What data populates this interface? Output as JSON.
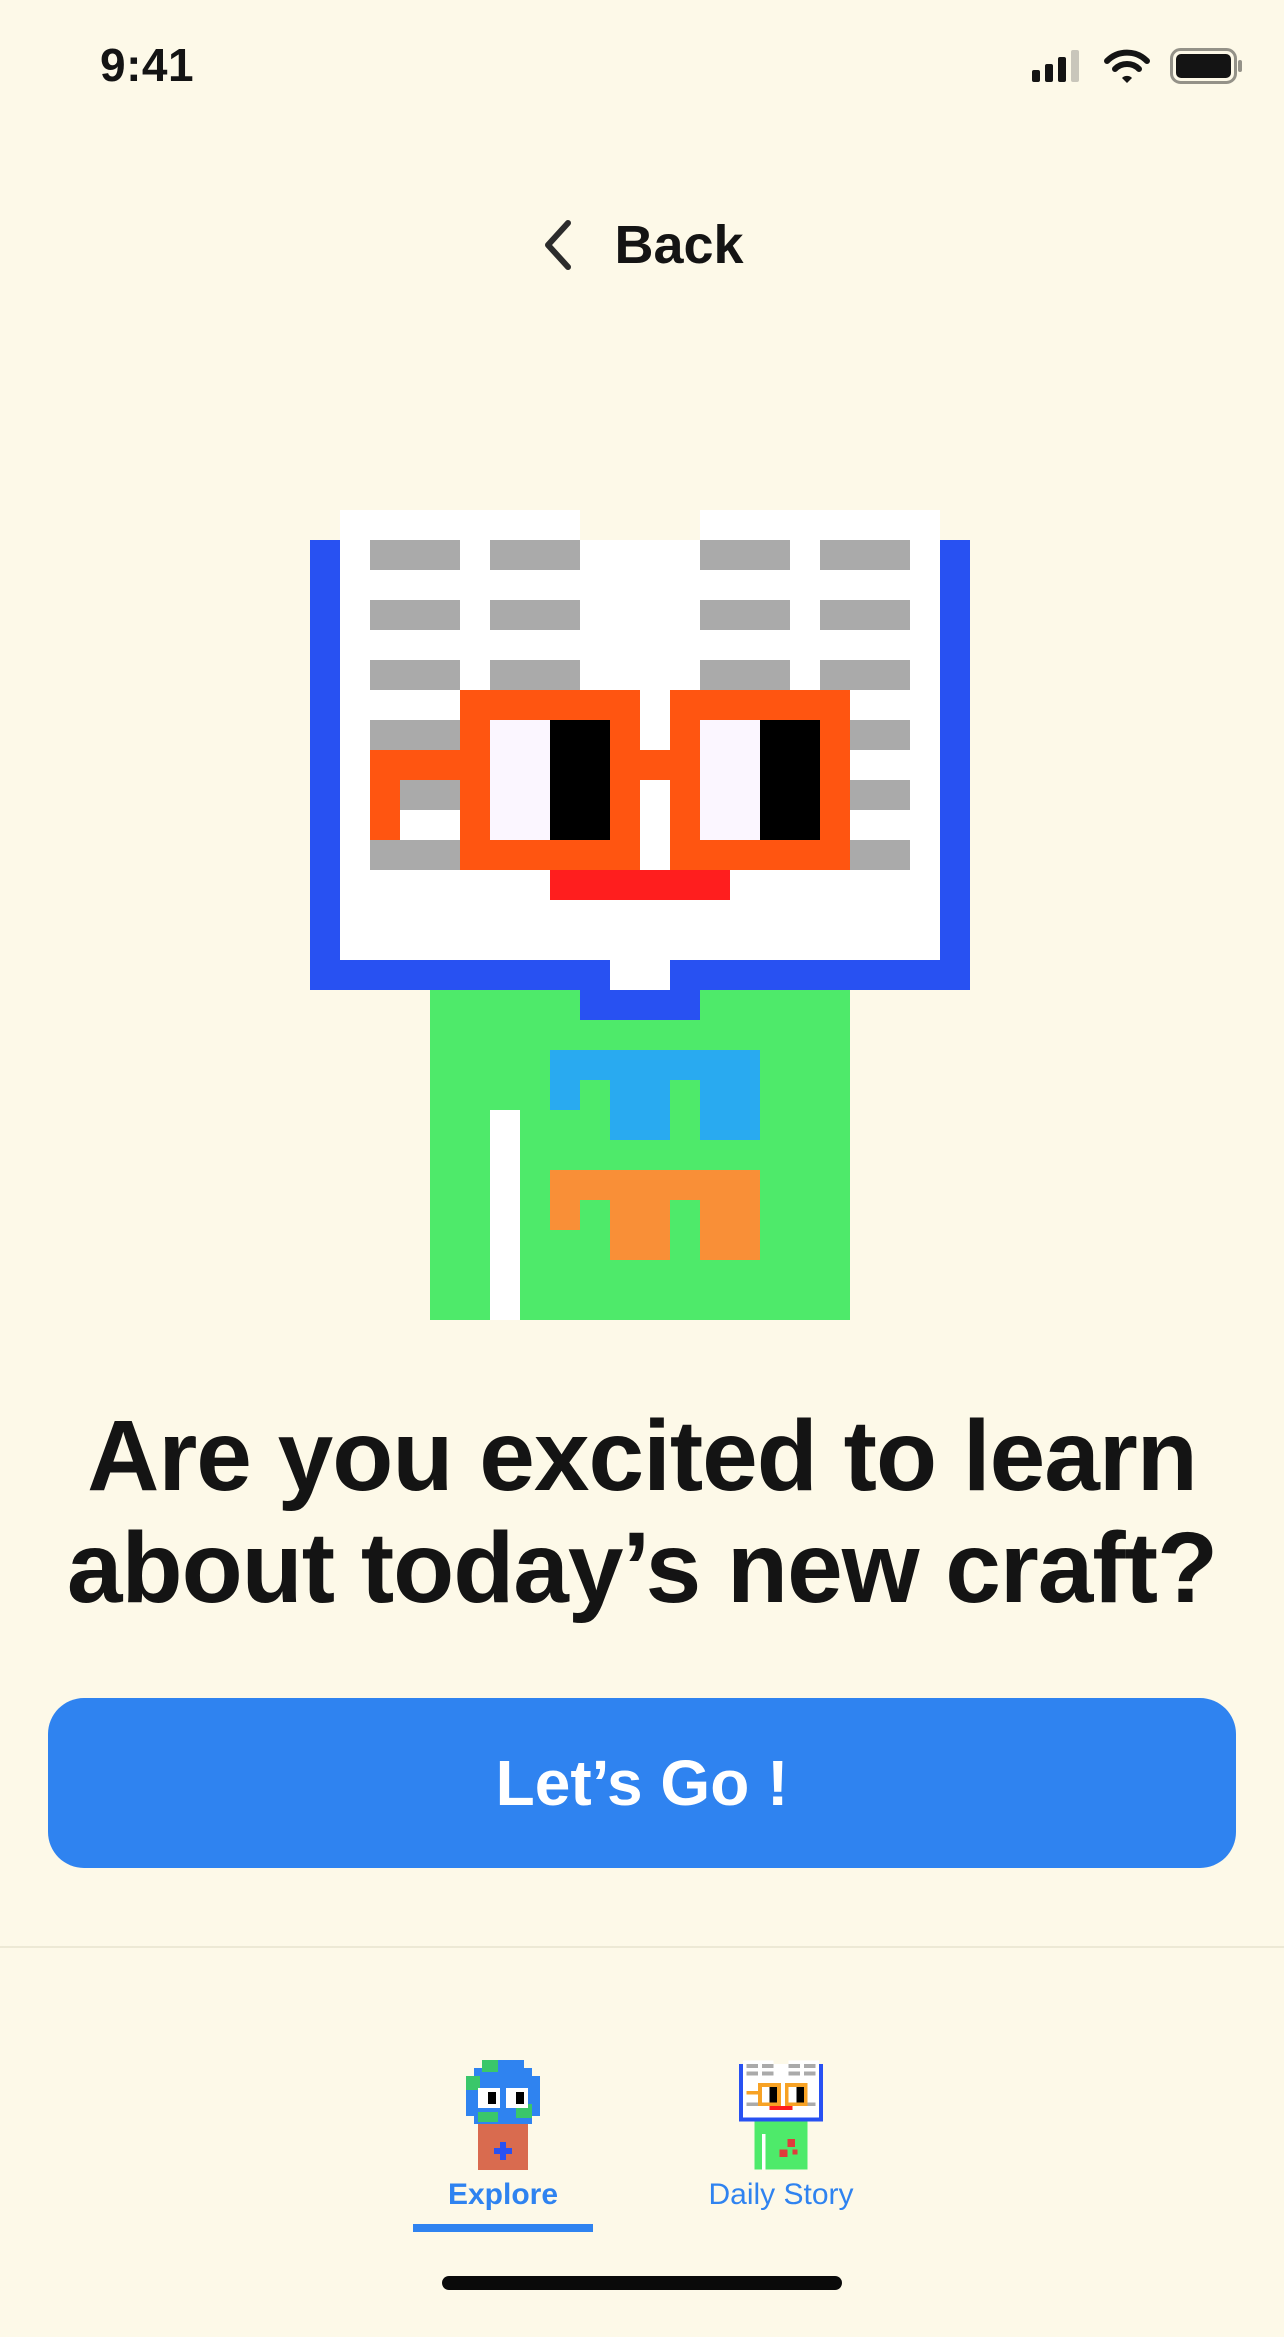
{
  "status_bar": {
    "time": "9:41"
  },
  "nav": {
    "back_label": "Back"
  },
  "main": {
    "headline_line1": "Are you excited to learn",
    "headline_line2": "about today’s new craft?",
    "cta_label": "Let’s Go !"
  },
  "tab_bar": {
    "tabs": [
      {
        "label": "Explore",
        "active": true,
        "icon": "globe-character-icon"
      },
      {
        "label": "Daily Story",
        "active": false,
        "icon": "book-character-icon"
      }
    ]
  },
  "colors": {
    "background": "#FDF9E8",
    "accent": "#2F83F0",
    "text": "#141414"
  }
}
